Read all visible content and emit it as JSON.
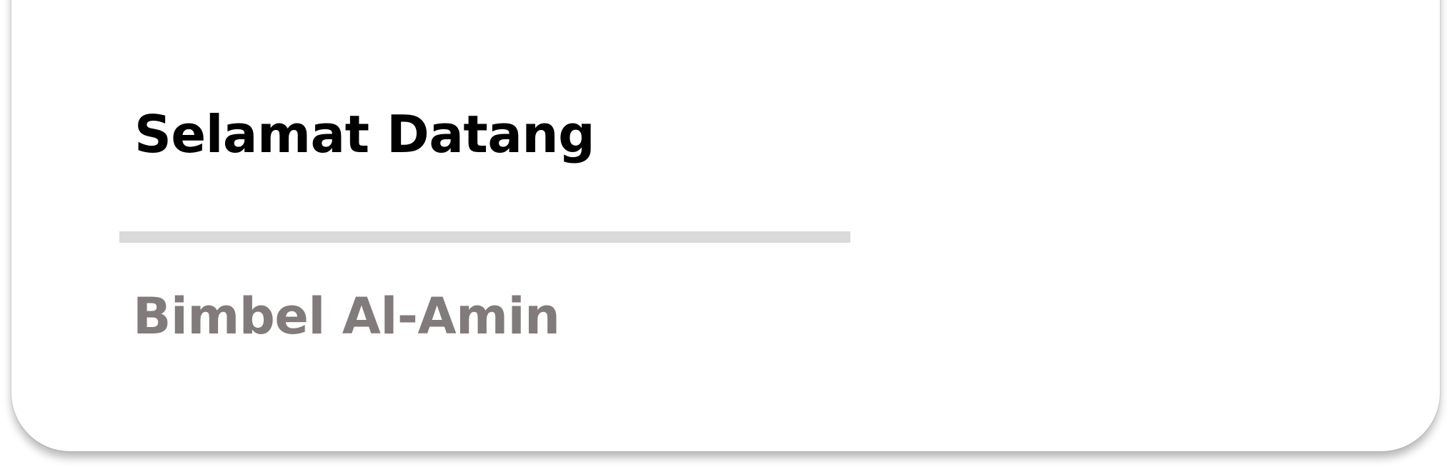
{
  "header": {
    "greeting": "Selamat Datang",
    "app_name": "Bimbel Al-Amin"
  },
  "colors": {
    "greeting_text": "#000000",
    "app_name_text": "#817b7b",
    "divider": "#dadada",
    "card_background": "#ffffff"
  }
}
